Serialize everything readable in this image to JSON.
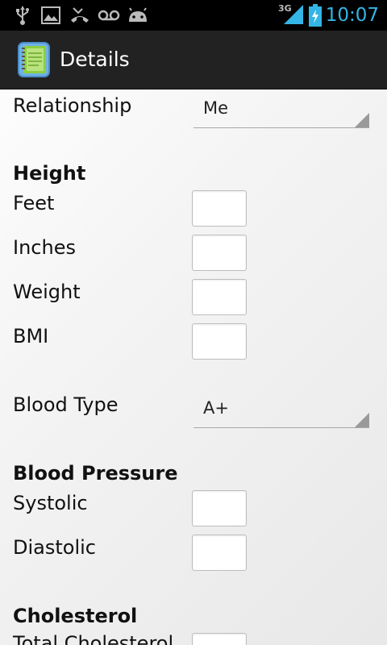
{
  "status_bar": {
    "network": "3G",
    "time": "10:07",
    "icons": [
      "usb-icon",
      "image-icon",
      "missed-call-icon",
      "voicemail-icon",
      "android-debug-icon",
      "signal-icon",
      "battery-charging-icon"
    ]
  },
  "action_bar": {
    "title": "Details",
    "icon": "notebook-app-icon"
  },
  "form": {
    "relationship": {
      "label": "Relationship",
      "value": "Me"
    },
    "height_section": "Height",
    "feet": {
      "label": "Feet",
      "value": ""
    },
    "inches": {
      "label": "Inches",
      "value": ""
    },
    "weight": {
      "label": "Weight",
      "value": ""
    },
    "bmi": {
      "label": "BMI",
      "value": ""
    },
    "blood_type": {
      "label": "Blood Type",
      "value": "A+"
    },
    "blood_pressure_section": "Blood Pressure",
    "systolic": {
      "label": "Systolic",
      "value": ""
    },
    "diastolic": {
      "label": "Diastolic",
      "value": ""
    },
    "cholesterol_section": "Cholesterol",
    "total_cholesterol": {
      "label": "Total Cholesterol",
      "value": ""
    }
  },
  "colors": {
    "accent": "#33b5e5",
    "action_bar": "#222222",
    "status_bar": "#000000"
  }
}
